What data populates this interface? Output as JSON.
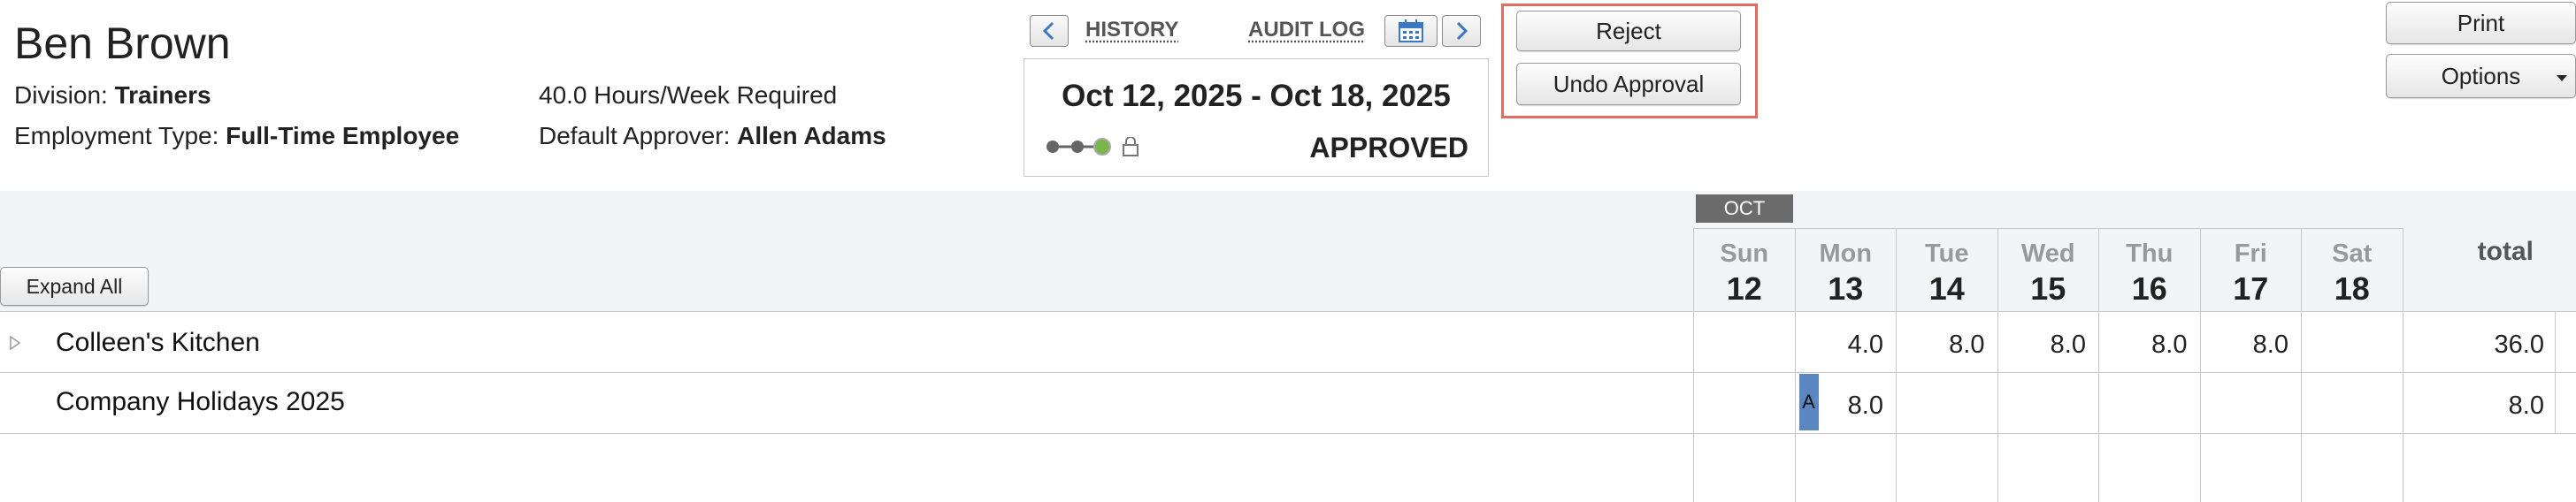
{
  "employee": {
    "name": "Ben Brown",
    "division_label": "Division:",
    "division": "Trainers",
    "employment_type_label": "Employment Type:",
    "employment_type": "Full-Time Employee",
    "hours_required": "40.0 Hours/Week Required",
    "approver_label": "Default Approver:",
    "approver": "Allen Adams"
  },
  "nav": {
    "history": "HISTORY",
    "audit_log": "AUDIT LOG",
    "prev_icon": "chevron-left-icon",
    "next_icon": "chevron-right-icon",
    "calendar_icon": "calendar-icon"
  },
  "period": {
    "dates": "Oct 12, 2025 - Oct 18, 2025",
    "status": "APPROVED",
    "progress_steps": 3,
    "progress_current": 3,
    "lock_icon": "lock-icon"
  },
  "actions": {
    "reject": "Reject",
    "undo_approval": "Undo Approval",
    "print": "Print",
    "options": "Options"
  },
  "grid": {
    "expand_all": "Expand All",
    "month": "OCT",
    "total_label": "total",
    "days": [
      {
        "name": "Sun",
        "num": "12"
      },
      {
        "name": "Mon",
        "num": "13"
      },
      {
        "name": "Tue",
        "num": "14"
      },
      {
        "name": "Wed",
        "num": "15"
      },
      {
        "name": "Thu",
        "num": "16"
      },
      {
        "name": "Fri",
        "num": "17"
      },
      {
        "name": "Sat",
        "num": "18"
      }
    ],
    "rows": [
      {
        "label": "Colleen's Kitchen",
        "values": [
          "",
          "4.0",
          "8.0",
          "8.0",
          "8.0",
          "8.0",
          ""
        ],
        "total": "36.0"
      },
      {
        "label": "Company Holidays 2025",
        "values": [
          "",
          "8.0",
          "",
          "",
          "",
          "",
          ""
        ],
        "total": "8.0",
        "marker": "A"
      }
    ]
  },
  "colors": {
    "accent": "#3a78c2",
    "highlight": "#e06b5f",
    "marker": "#5a86c2",
    "progress_done": "#7ab648"
  }
}
